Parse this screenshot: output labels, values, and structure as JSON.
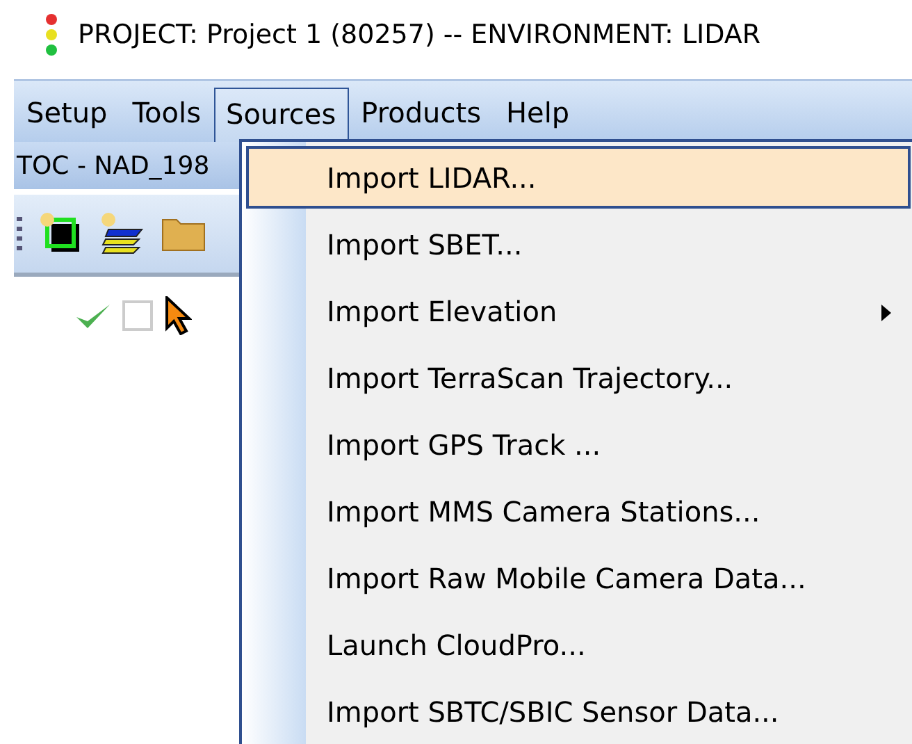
{
  "window": {
    "title": "PROJECT:  Project 1 (80257)  --  ENVIRONMENT:  LIDAR"
  },
  "menubar": [
    {
      "label": "Setup",
      "selected": false
    },
    {
      "label": "Tools",
      "selected": false
    },
    {
      "label": "Sources",
      "selected": true
    },
    {
      "label": "Products",
      "selected": false
    },
    {
      "label": "Help",
      "selected": false
    }
  ],
  "toc": {
    "title": "TOC - NAD_198",
    "row": {
      "checked": false
    }
  },
  "menu": [
    {
      "label": "Import LIDAR...",
      "selected": true,
      "has_submenu": false
    },
    {
      "label": "Import SBET...",
      "selected": false,
      "has_submenu": false
    },
    {
      "label": "Import Elevation",
      "selected": false,
      "has_submenu": true
    },
    {
      "label": "Import TerraScan Trajectory...",
      "selected": false,
      "has_submenu": false
    },
    {
      "label": "Import GPS Track ...",
      "selected": false,
      "has_submenu": false
    },
    {
      "label": "Import MMS Camera Stations...",
      "selected": false,
      "has_submenu": false
    },
    {
      "label": "Import Raw Mobile Camera Data...",
      "selected": false,
      "has_submenu": false
    },
    {
      "label": "Launch CloudPro...",
      "selected": false,
      "has_submenu": false
    },
    {
      "label": "Import SBTC/SBIC Sensor Data...",
      "selected": false,
      "has_submenu": false
    }
  ]
}
